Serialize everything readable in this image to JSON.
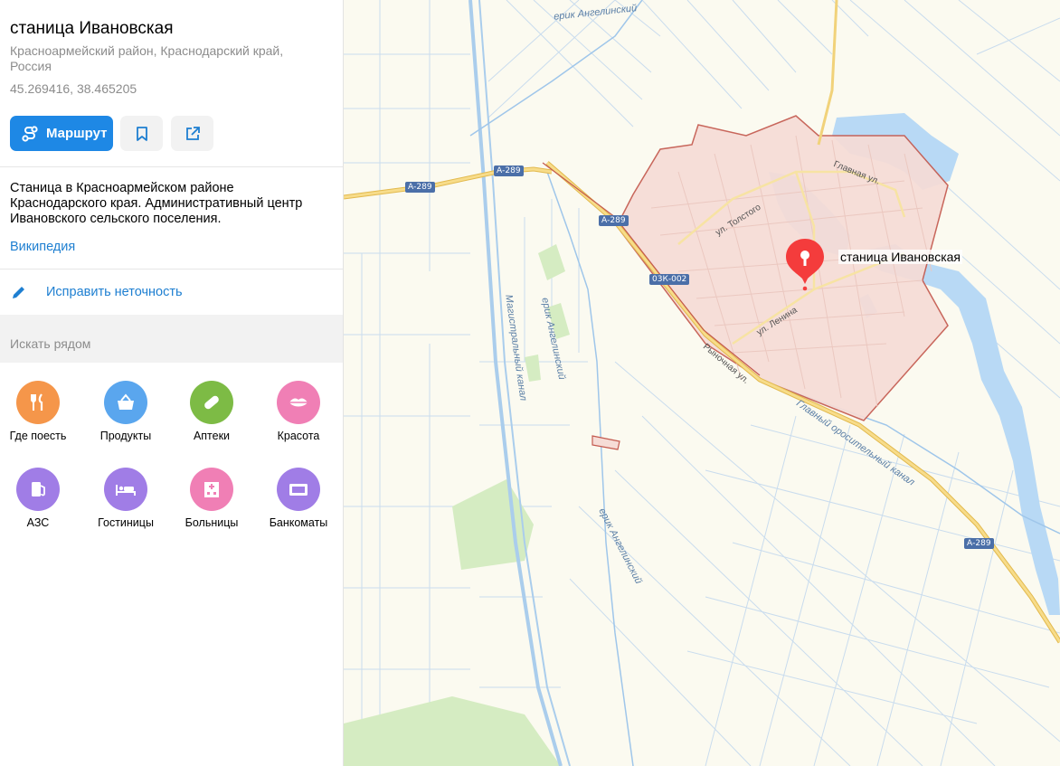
{
  "place": {
    "title": "станица Ивановская",
    "subtitle": "Красноармейский район, Краснодарский край, Россия",
    "coords": "45.269416, 38.465205"
  },
  "actions": {
    "route_label": "Маршрут",
    "bookmark_icon": "bookmark-icon",
    "share_icon": "share-icon"
  },
  "description": "Станица в Красноармейском районе Краснодарского края. Административный центр Ивановского сельского поселения.",
  "wiki_link": "Википедия",
  "fix_link": "Исправить неточность",
  "nearby": {
    "search_label": "Искать рядом",
    "categories": [
      {
        "label": "Где поесть",
        "color": "#f5964a",
        "icon": "fork-knife-icon"
      },
      {
        "label": "Продукты",
        "color": "#5aa6ee",
        "icon": "basket-icon"
      },
      {
        "label": "Аптеки",
        "color": "#7dbb45",
        "icon": "pill-icon"
      },
      {
        "label": "Красота",
        "color": "#f07fb5",
        "icon": "lips-icon"
      },
      {
        "label": "АЗС",
        "color": "#a07de6",
        "icon": "fuel-icon"
      },
      {
        "label": "Гостиницы",
        "color": "#a07de6",
        "icon": "bed-icon"
      },
      {
        "label": "Больницы",
        "color": "#f07fb5",
        "icon": "hospital-icon"
      },
      {
        "label": "Банкоматы",
        "color": "#a07de6",
        "icon": "atm-icon"
      }
    ]
  },
  "map": {
    "pin_label": "станица Ивановская",
    "labels": {
      "erik_top": "ерик Ангелинский",
      "erik_mid": "ерик Ангелинский",
      "erik_low": "ерик Ангелинский",
      "canal": "Магистральный канал",
      "main_canal": "Главный оросительный канал",
      "tolstogo": "ул. Толстого",
      "glavnaya": "Главная ул.",
      "lenina": "ул. Ленина",
      "rynochnaya": "Рыночная ул."
    },
    "shields": {
      "a289_1": "А-289",
      "a289_2": "А-289",
      "a289_3": "А-289",
      "a289_4": "А-289",
      "r03k": "03К-002"
    },
    "colors": {
      "town_fill": "#f6dcd6",
      "town_border": "#c45a4f",
      "water": "#b8d9f5",
      "park": "#d5ecc2",
      "highway": "#f2cf6e",
      "pin": "#f43c3c"
    }
  }
}
